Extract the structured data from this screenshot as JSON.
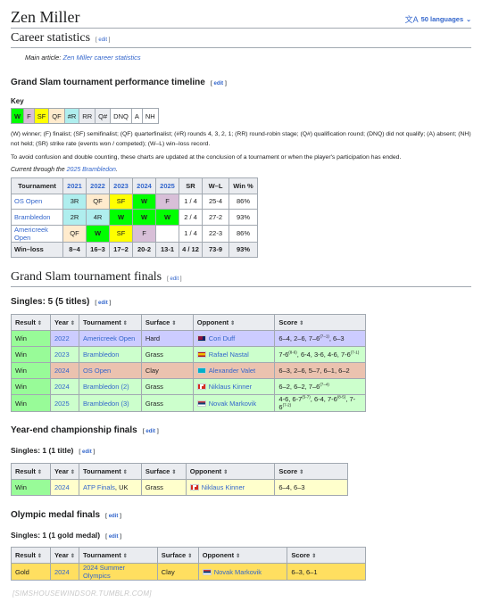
{
  "page_title": "Zen Miller",
  "languages": {
    "icon": "translate-icon",
    "label": "50 languages"
  },
  "edit_label": "edit",
  "career": {
    "heading": "Career statistics",
    "main_article_prefix": "Main article: ",
    "main_article_link": "Zen Miller career statistics"
  },
  "timeline": {
    "heading": "Grand Slam tournament performance timeline",
    "key_label": "Key",
    "key_cells": [
      "W",
      "F",
      "SF",
      "QF",
      "#R",
      "RR",
      "Q#",
      "DNQ",
      "A",
      "NH"
    ],
    "legend": "(W) winner; (F) finalist; (SF) semifinalist; (QF) quarterfinalist; (#R) rounds 4, 3, 2, 1; (RR) round-robin stage; (Q#) qualification round; (DNQ) did not qualify; (A) absent; (NH) not held; (SR) strike rate (events won / competed); (W–L) win–loss record.",
    "note": "To avoid confusion and double counting, these charts are updated at the conclusion of a tournament or when the player's participation has ended.",
    "current_prefix": "Current through the ",
    "current_link": "2025 Brambledon",
    "current_suffix": ".",
    "headers": [
      "Tournament",
      "2021",
      "2022",
      "2023",
      "2024",
      "2025",
      "SR",
      "W–L",
      "Win %"
    ],
    "rows": [
      {
        "name": "OS Open",
        "cells": [
          "3R",
          "QF",
          "SF",
          "W",
          "F"
        ],
        "sr": "1 / 4",
        "wl": "25-4",
        "pct": "86%"
      },
      {
        "name": "Brambledon",
        "cells": [
          "2R",
          "4R",
          "W",
          "W",
          "W"
        ],
        "sr": "2 / 4",
        "wl": "27-2",
        "pct": "93%"
      },
      {
        "name": "Americreek Open",
        "cells": [
          "QF",
          "W",
          "SF",
          "F",
          ""
        ],
        "sr": "1 / 4",
        "wl": "22-3",
        "pct": "86%"
      }
    ],
    "total": {
      "name": "Win–loss",
      "cells": [
        "8–4",
        "16–3",
        "17–2",
        "20-2",
        "13-1"
      ],
      "sr": "4 / 12",
      "wl": "73-9",
      "pct": "93%"
    }
  },
  "gs_finals": {
    "heading": "Grand Slam tournament finals",
    "subheading": "Singles: 5 (5 titles)",
    "headers": [
      "Result",
      "Year",
      "Tournament",
      "Surface",
      "Opponent",
      "Score"
    ],
    "rows": [
      {
        "result": "Win",
        "year": "2022",
        "tournament": "Americreek Open",
        "surface": "Hard",
        "flag": "flag-australia",
        "opponent": "Cori Duff",
        "score": "6–4, 2–6, 7–6(7–1), 6–3",
        "color": "#ccccff"
      },
      {
        "result": "Win",
        "year": "2023",
        "tournament": "Brambledon",
        "surface": "Grass",
        "flag": "flag-spain",
        "opponent": "Rafael Nastal",
        "score": "7-6(8-6), 6-4, 3-6, 4-6, 7-6(7-1)",
        "color": "#ccffcc"
      },
      {
        "result": "Win",
        "year": "2024",
        "tournament": "OS Open",
        "surface": "Clay",
        "flag": "flag-kazakhstan",
        "opponent": "Alexander Valet",
        "score": "6–3, 2–6, 5–7, 6–1, 6–2",
        "color": "#ebc2af"
      },
      {
        "result": "Win",
        "year": "2024",
        "tournament": "Brambledon (2)",
        "surface": "Grass",
        "flag": "flag-canada",
        "opponent": "Niklaus Kinner",
        "score": "6–2, 6–2, 7–6(7–4)",
        "color": "#ccffcc"
      },
      {
        "result": "Win",
        "year": "2025",
        "tournament": "Brambledon (3)",
        "surface": "Grass",
        "flag": "flag-serbia",
        "opponent": "Novak Markovik",
        "score": "4-6, 6-7(5-7), 6-4, 7-6(8-5), 7-6(7-2)",
        "color": "#ccffcc"
      }
    ]
  },
  "yec_finals": {
    "heading": "Year-end championship finals",
    "subheading": "Singles: 1 (1 title)",
    "headers": [
      "Result",
      "Year",
      "Tournament",
      "Surface",
      "Opponent",
      "Score"
    ],
    "rows": [
      {
        "result": "Win",
        "year": "2024",
        "tournament": "ATP Finals",
        "tournament_suffix": ", UK",
        "surface": "Grass",
        "flag": "flag-canada",
        "opponent": "Niklaus Kinner",
        "score": "6–4, 6–3",
        "color": "#ffffcc"
      }
    ]
  },
  "olympic_finals": {
    "heading": "Olympic medal finals",
    "subheading": "Singles: 1 (1 gold medal)",
    "headers": [
      "Result",
      "Year",
      "Tournament",
      "Surface",
      "Opponent",
      "Score"
    ],
    "rows": [
      {
        "result": "Gold",
        "year": "2024",
        "tournament": "2024 Summer Olympics",
        "surface": "Clay",
        "flag": "flag-serbia",
        "opponent": "Novak Markovik",
        "score": "6–3, 6–1",
        "color": "#ffdf60"
      }
    ]
  },
  "watermark": "[SIMSHOUSEWINDSOR.TUMBLR.COM]",
  "colors": {
    "win": "#00ff00",
    "finalist": "#d8bfd8",
    "semifinal": "#ffff00",
    "quarterfinal": "#ffebcd",
    "rounds": "#afeeee",
    "hard": "#ccccff",
    "grass": "#ccffcc",
    "clay": "#ebc2af",
    "yec": "#ffffcc",
    "gold": "#ffdf60",
    "result_win": "#98fb98",
    "link": "#3366cc"
  }
}
